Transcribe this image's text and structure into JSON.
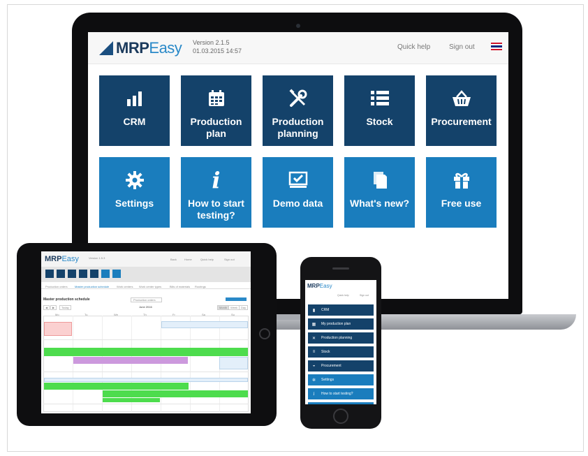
{
  "laptop": {
    "logo": {
      "part1": "MRP",
      "part2": "Easy"
    },
    "version_line1": "Version 2.1.5",
    "version_line2": "01.03.2015 14:57",
    "quick_help": "Quick help",
    "sign_out": "Sign out",
    "tiles": [
      {
        "label": "CRM",
        "icon": "bar-chart-icon",
        "color": "#14426a"
      },
      {
        "label": "Production plan",
        "icon": "calendar-icon",
        "color": "#14426a"
      },
      {
        "label": "Production planning",
        "icon": "tools-icon",
        "color": "#14426a"
      },
      {
        "label": "Stock",
        "icon": "list-icon",
        "color": "#14426a"
      },
      {
        "label": "Procurement",
        "icon": "basket-icon",
        "color": "#14426a"
      },
      {
        "label": "Settings",
        "icon": "gear-icon",
        "color": "#1a7dbd"
      },
      {
        "label": "How to start testing?",
        "icon": "info-icon",
        "color": "#1a7dbd"
      },
      {
        "label": "Demo data",
        "icon": "checkbox-screen-icon",
        "color": "#1a7dbd"
      },
      {
        "label": "What's new?",
        "icon": "documents-icon",
        "color": "#1a7dbd"
      },
      {
        "label": "Free use",
        "icon": "gift-icon",
        "color": "#1a7dbd"
      }
    ]
  },
  "tablet": {
    "logo": {
      "part1": "MRP",
      "part2": "Easy"
    },
    "version": "Version 1.5.3",
    "links": [
      "Back",
      "Home",
      "Quick help",
      "Sign out"
    ],
    "tabs": [
      "Production orders",
      "Master production schedule",
      "Work centers",
      "Work center types",
      "Bills of materials",
      "Routings"
    ],
    "page_title": "Master production schedule",
    "filter": "Production orders",
    "month": "June 2016",
    "view_buttons": [
      "Month",
      "Week",
      "Day"
    ],
    "nav_buttons": [
      "◀",
      "▶",
      "Today"
    ],
    "weekdays": [
      "Mo",
      "Tu",
      "We",
      "Th",
      "Fr",
      "Sa",
      "Su"
    ]
  },
  "phone": {
    "logo": {
      "part1": "MRP",
      "part2": "Easy"
    },
    "quick_help": "Quick help",
    "sign_out": "Sign out",
    "menu": [
      {
        "label": "CRM",
        "icon": "bar-chart-icon",
        "color": "#14426a"
      },
      {
        "label": "My production plan",
        "icon": "calendar-icon",
        "color": "#14426a"
      },
      {
        "label": "Production planning",
        "icon": "tools-icon",
        "color": "#14426a"
      },
      {
        "label": "Stock",
        "icon": "list-icon",
        "color": "#14426a"
      },
      {
        "label": "Procurement",
        "icon": "basket-icon",
        "color": "#14426a"
      },
      {
        "label": "Settings",
        "icon": "gear-icon",
        "color": "#1a7dbd"
      },
      {
        "label": "How to start testing?",
        "icon": "info-icon",
        "color": "#1a7dbd"
      }
    ]
  }
}
